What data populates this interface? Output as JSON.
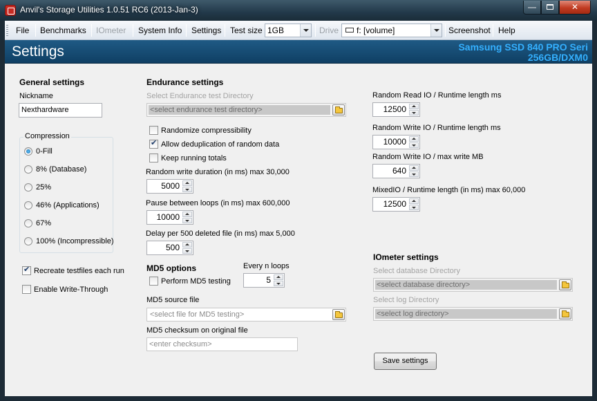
{
  "window": {
    "title": "Anvil's Storage Utilities 1.0.51 RC6 (2013-Jan-3)",
    "minimize": "—",
    "close": "✕"
  },
  "menu": {
    "file": "File",
    "benchmarks": "Benchmarks",
    "iometer": "IOmeter",
    "system_info": "System Info",
    "settings": "Settings",
    "test_size_label": "Test size",
    "test_size_value": "1GB",
    "drive_label": "Drive",
    "drive_value": "f: [volume]",
    "screenshot": "Screenshot",
    "help": "Help"
  },
  "header": {
    "title": "Settings",
    "drive_line1": "Samsung SSD 840 PRO Seri",
    "drive_line2": "256GB/DXM0"
  },
  "general": {
    "heading": "General settings",
    "nickname_label": "Nickname",
    "nickname_value": "Nexthardware",
    "compression_title": "Compression",
    "compression_options": [
      "0-Fill",
      "8% (Database)",
      "25%",
      "46% (Applications)",
      "67%",
      "100% (Incompressible)"
    ],
    "compression_selected_index": 0,
    "recreate_label": "Recreate testfiles each run",
    "recreate_checked": true,
    "write_through_label": "Enable Write-Through",
    "write_through_checked": false
  },
  "endurance": {
    "heading": "Endurance settings",
    "dir_label": "Select Endurance test Directory",
    "dir_placeholder": "<select endurance test directory>",
    "randomize_label": "Randomize compressibility",
    "randomize_checked": false,
    "dedup_label": "Allow deduplication of random data",
    "dedup_checked": true,
    "running_totals_label": "Keep running totals",
    "running_totals_checked": false,
    "rw_duration_label": "Random write duration (in ms) max 30,000",
    "rw_duration_value": "5000",
    "pause_label": "Pause between loops (in ms) max 600,000",
    "pause_value": "10000",
    "delay_label": "Delay per 500 deleted file (in ms) max 5,000",
    "delay_value": "500"
  },
  "md5": {
    "heading": "MD5 options",
    "every_n_label": "Every n loops",
    "every_n_value": "5",
    "perform_label": "Perform MD5 testing",
    "perform_checked": false,
    "source_label": "MD5 source file",
    "source_placeholder": "<select file for MD5 testing>",
    "checksum_label": "MD5 checksum on original file",
    "checksum_placeholder": "<enter checksum>"
  },
  "random_io": {
    "read_label": "Random Read IO / Runtime length ms",
    "read_value": "12500",
    "write_label": "Random Write IO / Runtime length ms",
    "write_value": "10000",
    "write_max_label": "Random Write IO / max write MB",
    "write_max_value": "640",
    "mixed_label": "MixedIO / Runtime length (in ms) max 60,000",
    "mixed_value": "12500"
  },
  "iometer": {
    "heading": "IOmeter settings",
    "db_label": "Select database Directory",
    "db_placeholder": "<select database directory>",
    "log_label": "Select log Directory",
    "log_placeholder": "<select log directory>"
  },
  "save_button": "Save settings"
}
